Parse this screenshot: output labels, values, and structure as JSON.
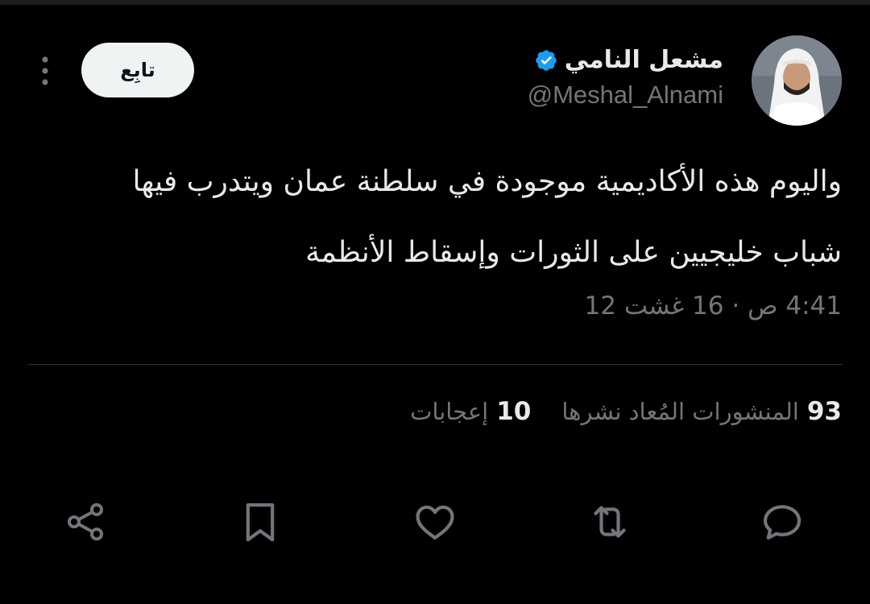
{
  "tweet": {
    "author": {
      "display_name": "مشعل النامي",
      "handle": "@Meshal_Alnami",
      "verified": true
    },
    "follow_label": "تابِع",
    "text": "واليوم هذه الأكاديمية موجودة في سلطنة عمان ويتدرب فيها\nشباب خليجيين على الثورات وإسقاط الأنظمة",
    "timestamp": "4:41 ص · 16 غشت 12",
    "stats": {
      "reposts_count": "93",
      "reposts_label": "المنشورات المُعاد نشرها",
      "likes_count": "10",
      "likes_label": "إعجابات"
    },
    "actions": [
      "reply-icon",
      "repost-icon",
      "like-icon",
      "bookmark-icon",
      "share-icon"
    ]
  },
  "colors": {
    "background": "#000000",
    "primary_text": "#e7e9ea",
    "secondary_text": "#71767b",
    "verified": "#1d9bf0",
    "follow_button_bg": "#eff3f4",
    "divider": "#2f3336"
  }
}
